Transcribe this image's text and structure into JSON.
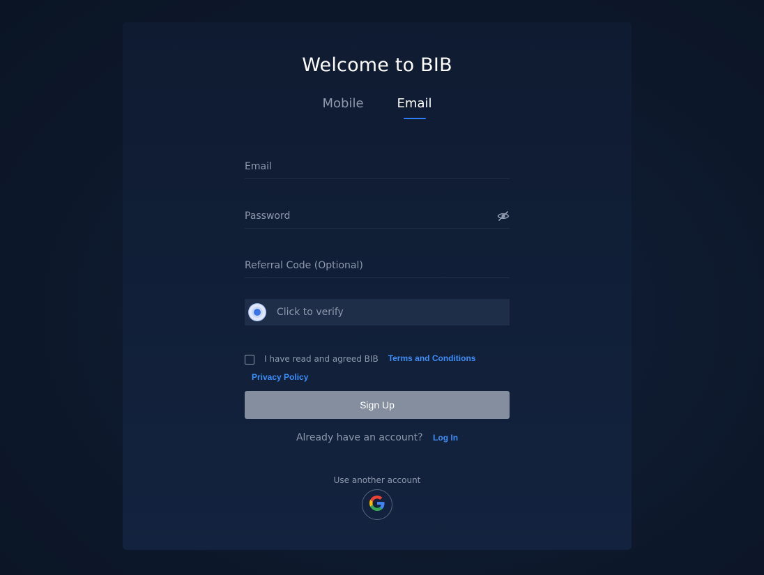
{
  "header": {
    "title": "Welcome to BIB"
  },
  "tabs": [
    {
      "label": "Mobile",
      "active": false
    },
    {
      "label": "Email",
      "active": true
    }
  ],
  "form": {
    "email_placeholder": "Email",
    "password_placeholder": "Password",
    "referral_placeholder": "Referral Code (Optional)",
    "verify_label": "Click to verify",
    "agree_text": "I have read and agreed BIB",
    "terms_link": "Terms and Conditions",
    "privacy_link": "Privacy Policy",
    "signup_label": "Sign Up",
    "login_prompt": "Already have an account?",
    "login_link": "Log In",
    "other_account": "Use another account"
  },
  "icons": {
    "password_toggle": "eye-hidden-icon",
    "verify": "captcha-icon",
    "social": "google-icon"
  },
  "colors": {
    "accent": "#2f7cf6",
    "link": "#3d8ef7",
    "button_disabled": "#848e9f",
    "card_bg": "#0f1b31"
  }
}
